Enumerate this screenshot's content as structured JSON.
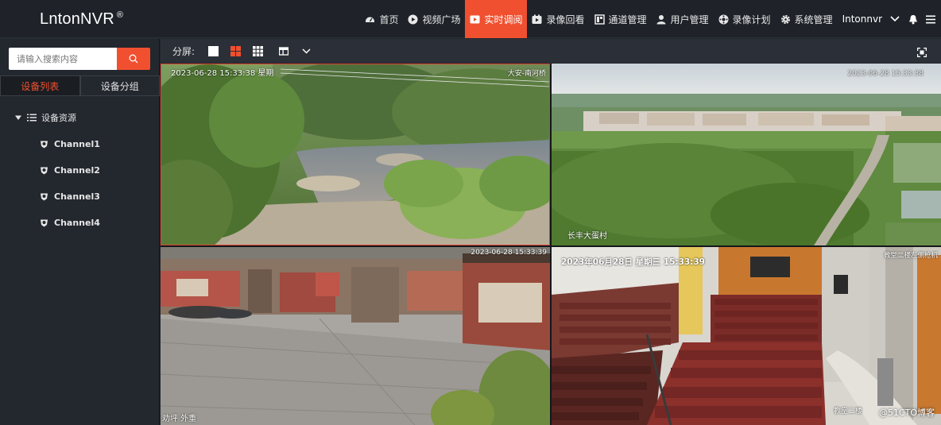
{
  "header": {
    "brand": "LntonNVR",
    "brand_mark": "®",
    "nav": [
      {
        "label": "首页",
        "icon": "dashboard-icon",
        "active": false
      },
      {
        "label": "视频广场",
        "icon": "play-icon",
        "active": false
      },
      {
        "label": "实时调阅",
        "icon": "live-video-icon",
        "active": true
      },
      {
        "label": "录像回看",
        "icon": "playback-icon",
        "active": false
      },
      {
        "label": "通道管理",
        "icon": "channel-icon",
        "active": false
      },
      {
        "label": "用户管理",
        "icon": "user-icon",
        "active": false
      },
      {
        "label": "录像计划",
        "icon": "schedule-icon",
        "active": false
      },
      {
        "label": "系统管理",
        "icon": "gear-icon",
        "active": false
      }
    ],
    "user": "Intonnvr"
  },
  "sidebar": {
    "search_placeholder": "请输入搜索内容",
    "tabs": [
      {
        "label": "设备列表",
        "active": true
      },
      {
        "label": "设备分组",
        "active": false
      }
    ],
    "tree_root": "设备资源",
    "channels": [
      "Channel1",
      "Channel2",
      "Channel3",
      "Channel4"
    ]
  },
  "toolbar": {
    "split_label": "分屏:"
  },
  "videos": [
    {
      "timestamp": "2023-06-28 15:33:38 星期",
      "corner": "大安-南河桥",
      "label": ""
    },
    {
      "timestamp": "2023-06-28 15:33:38",
      "corner": "",
      "label": "长丰大蛋村"
    },
    {
      "timestamp": "2023-06-28 15:33:39",
      "corner": "",
      "label": "劝坪 外重"
    },
    {
      "timestamp": "2023年06月28日  星期三  15:33:39",
      "corner": "教堂二楼左侧枪机",
      "label": "教堂二楼"
    }
  ],
  "watermark": "@51CTO博客",
  "colors": {
    "accent": "#f0502f",
    "topbar": "#1f2329",
    "sidebar": "#23272e"
  }
}
